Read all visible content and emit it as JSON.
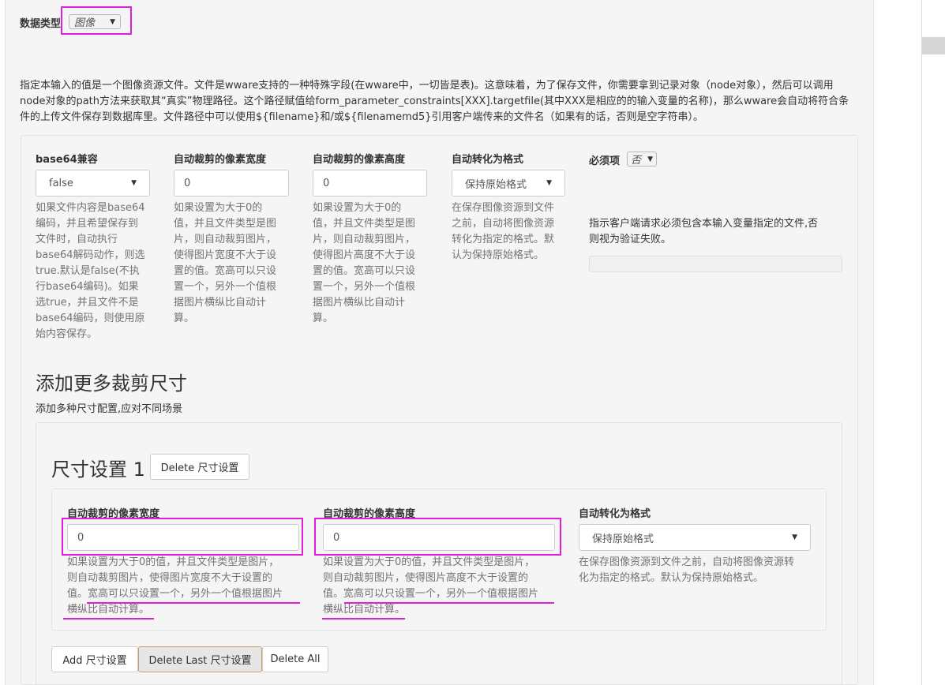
{
  "datatype": {
    "label": "数据类型",
    "value": "图像"
  },
  "description": "指定本输入的值是一个图像资源文件。文件是wware支持的一种特殊字段(在wware中，一切皆是表)。这意味着，为了保存文件，你需要拿到记录对象（node对象），然后可以调用node对象的path方法来获取其“真实”物理路径。这个路径赋值给form_parameter_constraints[XXX].targetfile(其中XXX是相应的的输入变量的名称)，那么wware会自动将符合条件的上传文件保存到数据库里。文件路径中可以使用${filename}和/或${filenamemd5}引用客户端传来的文件名（如果有的话，否则是空字符串）。",
  "fields": {
    "base64": {
      "label": "base64兼容",
      "value": "false",
      "help": [
        "如果文件内容是base64",
        "编码，并且希望保存到",
        "文件时，自动执行",
        "base64解码动作，则选",
        "true.默认是false(不执",
        "行base64编码)。如果",
        "选true，并且文件不是",
        "base64编码，则使用原",
        "始内容保存。"
      ]
    },
    "width": {
      "label": "自动裁剪的像素宽度",
      "value": "0",
      "help": [
        "如果设置为大于0的",
        "值，并且文件类型是图",
        "片，则自动裁剪图片，",
        "使得图片宽度不大于设",
        "置的值。宽高可以只设",
        "置一个，另外一个值根",
        "据图片横纵比自动计",
        "算。"
      ]
    },
    "height": {
      "label": "自动裁剪的像素高度",
      "value": "0",
      "help": [
        "如果设置为大于0的",
        "值，并且文件类型是图",
        "片，则自动裁剪图片，",
        "使得图片高度不大于设",
        "置的值。宽高可以只设",
        "置一个，另外一个值根",
        "据图片横纵比自动计",
        "算。"
      ]
    },
    "format": {
      "label": "自动转化为格式",
      "value": "保持原始格式",
      "help": [
        "在保存图像资源到文件",
        "之前，自动将图像资源",
        "转化为指定的格式。默",
        "认为保持原始格式。"
      ]
    },
    "required": {
      "label": "必须项",
      "value": "否",
      "help": [
        "指示客户端请求必须包含本输入变量指定的文件,否",
        "则视为验证失败。"
      ]
    }
  },
  "more_sizes": {
    "title": "添加更多裁剪尺寸",
    "subtitle": "添加多种尺寸配置,应对不同场景"
  },
  "size_setting": {
    "title": "尺寸设置 1",
    "delete_label": "Delete 尺寸设置",
    "width": {
      "label": "自动裁剪的像素宽度",
      "value": "0",
      "help": [
        "如果设置为大于0的值，并且文件类型是图片，",
        "则自动裁剪图片，使得图片宽度不大于设置的",
        "值。宽高可以只设置一个，另外一个值根据图片",
        "横纵比自动计算。"
      ]
    },
    "height": {
      "label": "自动裁剪的像素高度",
      "value": "0",
      "help": [
        "如果设置为大于0的值，并且文件类型是图片，",
        "则自动裁剪图片，使得图片高度不大于设置的",
        "值。宽高可以只设置一个，另外一个值根据图片",
        "横纵比自动计算。"
      ]
    },
    "format": {
      "label": "自动转化为格式",
      "value": "保持原始格式",
      "help": [
        "在保存图像资源到文件之前，自动将图像资源转",
        "化为指定的格式。默认为保持原始格式。"
      ]
    }
  },
  "buttons": {
    "add": "Add 尺寸设置",
    "delete_last": "Delete Last 尺寸设置",
    "delete_all": "Delete All"
  },
  "colors": {
    "highlight": "#e020d8",
    "panel": "#f5f5f5"
  }
}
